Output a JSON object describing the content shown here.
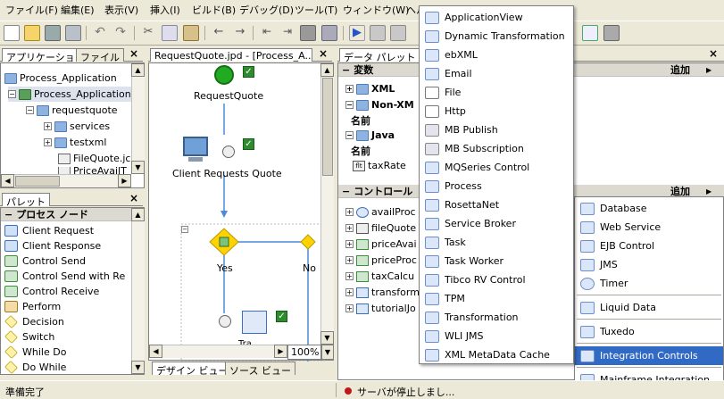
{
  "menubar": {
    "items": [
      "ファイル(F)",
      "編集(E)",
      "表示(V)",
      "挿入(I)",
      "ビルド(B)",
      "デバッグ(D)",
      "ツール(T)",
      "ウィンドウ(W)",
      "ヘルプ(H)"
    ]
  },
  "app_panel": {
    "tabs": [
      "アプリケーション",
      "ファイル"
    ],
    "tree": [
      {
        "label": "Process_Application"
      },
      {
        "label": "Process_Application"
      },
      {
        "label": "requestquote"
      },
      {
        "label": "services"
      },
      {
        "label": "testxml"
      },
      {
        "label": "FileQuote.jc"
      },
      {
        "label": "PriceAvailT"
      }
    ]
  },
  "palette_panel": {
    "tab": "パレット",
    "section": "プロセス ノード",
    "items": [
      "Client Request",
      "Client Response",
      "Control Send",
      "Control Send with Re",
      "Control Receive",
      "Perform",
      "Decision",
      "Switch",
      "While Do",
      "Do While"
    ]
  },
  "editor": {
    "tab": "RequestQuote.jpd - [Process_A...",
    "nodes": {
      "start": "RequestQuote",
      "client": "Client Requests Quote",
      "yes": "Yes",
      "no": "No",
      "cut": "Tra..."
    },
    "zoom": "100%",
    "bottom_tabs": [
      "デザイン ビュー",
      "ソース ビュー"
    ]
  },
  "data_palette": {
    "tab": "データ パレット",
    "vars_header": "変数",
    "vars_add": "追加",
    "vars": [
      {
        "label": "XML"
      },
      {
        "label": "Non-XM"
      },
      {
        "label": "名前"
      },
      {
        "label": "Java"
      },
      {
        "label": "名前"
      },
      {
        "label": "taxRate"
      }
    ],
    "controls_header": "コントロール",
    "controls_add": "追加",
    "controls": [
      "availProc",
      "fileQuote",
      "priceAvai",
      "priceProc",
      "taxCalcu",
      "transform",
      "tutorialJo"
    ]
  },
  "popup_menu": {
    "items": [
      "ApplicationView",
      "Dynamic Transformation",
      "ebXML",
      "Email",
      "File",
      "Http",
      "MB Publish",
      "MB Subscription",
      "MQSeries Control",
      "Process",
      "RosettaNet",
      "Service Broker",
      "Task",
      "Task Worker",
      "Tibco RV Control",
      "TPM",
      "Transformation",
      "WLI JMS",
      "XML MetaData Cache"
    ]
  },
  "side_menu": {
    "items": [
      "Database",
      "Web Service",
      "EJB Control",
      "JMS",
      "Timer",
      "Liquid Data",
      "Tuxedo",
      "Integration Controls",
      "Mainframe Integration"
    ],
    "highlighted": "Integration Controls"
  },
  "status": {
    "left": "準備完了",
    "server": "サーバが停止しまし..."
  },
  "colors": {
    "highlight": "#316ac5",
    "chrome": "#ece9d8",
    "start_node": "#22aa22",
    "decision": "#ffd200"
  }
}
